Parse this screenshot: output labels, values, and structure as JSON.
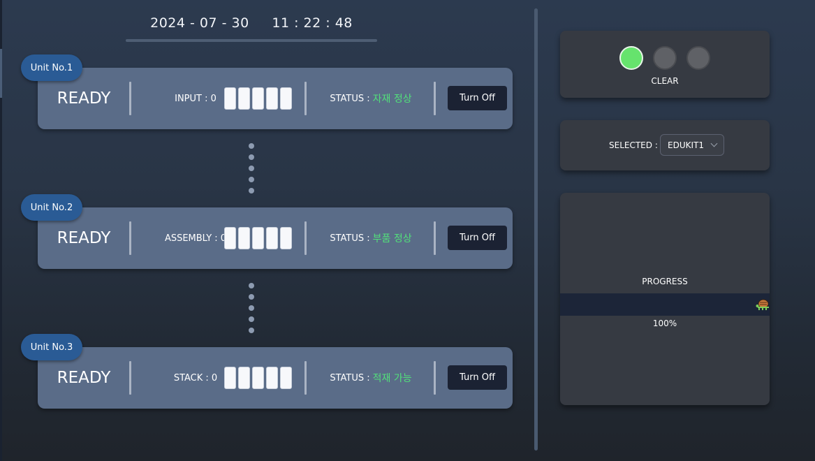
{
  "header": {
    "date": "2024 - 07 - 30",
    "time": "11 : 22 : 48"
  },
  "units": [
    {
      "badge": "Unit No.1",
      "state": "READY",
      "counter_label": "INPUT : 0",
      "status_label": "STATUS :",
      "status_value": "자재 정상",
      "button": "Turn Off"
    },
    {
      "badge": "Unit No.2",
      "state": "READY",
      "counter_label": "ASSEMBLY : 0",
      "status_label": "STATUS :",
      "status_value": "부품 정상",
      "button": "Turn Off"
    },
    {
      "badge": "Unit No.3",
      "state": "READY",
      "counter_label": "STACK : 0",
      "status_label": "STATUS :",
      "status_value": "적재 가능",
      "button": "Turn Off"
    }
  ],
  "signal_panel": {
    "lights": [
      "on",
      "off",
      "off"
    ],
    "label": "CLEAR"
  },
  "selector_panel": {
    "label": "SELECTED :",
    "value": "EDUKIT1"
  },
  "progress_panel": {
    "label": "PROGRESS",
    "percent_text": "100%",
    "percent": 100,
    "icon": "turtle-icon"
  },
  "colors": {
    "status_ok": "#52e07a",
    "light_on": "#66e36d",
    "light_off": "#5f6166",
    "badge": "#2a5b95",
    "button_dark": "#1b2233"
  }
}
